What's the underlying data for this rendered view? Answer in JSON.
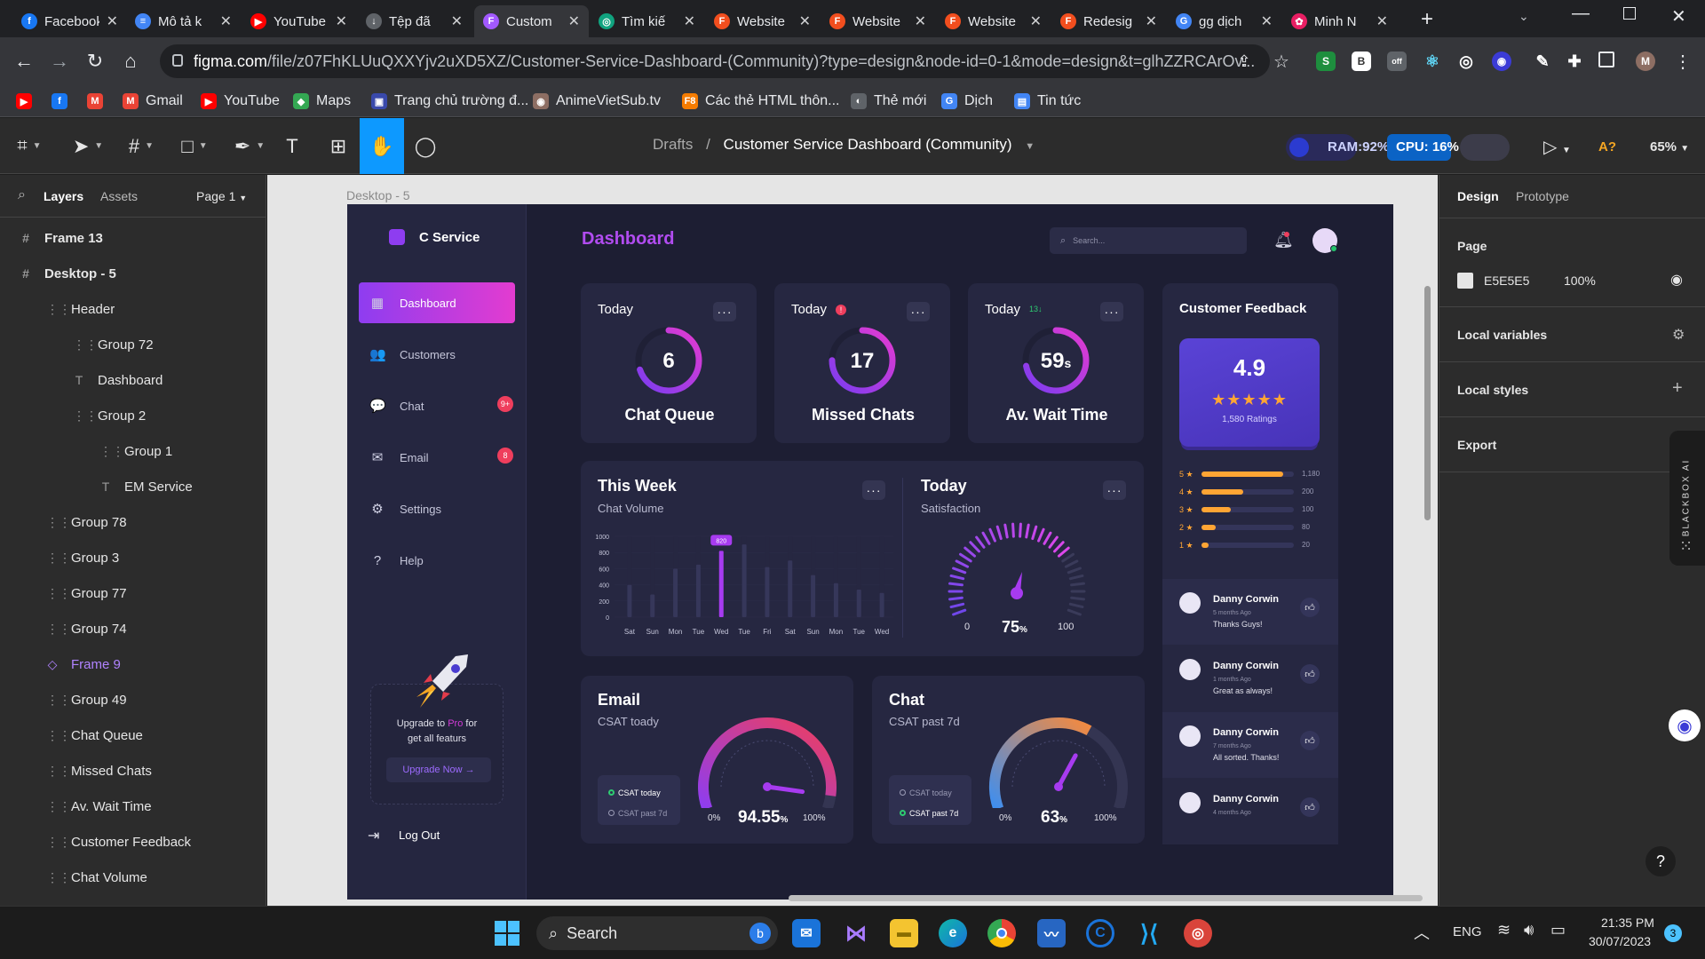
{
  "browser": {
    "tabs": [
      {
        "label": "Facebook",
        "color": "#1877f2",
        "glyph": "f"
      },
      {
        "label": "Mô tả k",
        "color": "#4285f4",
        "glyph": "≡"
      },
      {
        "label": "YouTube",
        "color": "#ff0000",
        "glyph": "▶"
      },
      {
        "label": "Tệp đã",
        "color": "#5f6368",
        "glyph": "↓"
      },
      {
        "label": "Custom",
        "color": "#a259ff",
        "glyph": "F"
      },
      {
        "label": "Tìm kiế",
        "color": "#10a37f",
        "glyph": "◎"
      },
      {
        "label": "Website",
        "color": "#f24e1e",
        "glyph": "F"
      },
      {
        "label": "Website",
        "color": "#f24e1e",
        "glyph": "F"
      },
      {
        "label": "Website",
        "color": "#f24e1e",
        "glyph": "F"
      },
      {
        "label": "Redesig",
        "color": "#f24e1e",
        "glyph": "F"
      },
      {
        "label": "gg dịch",
        "color": "#4285f4",
        "glyph": "G"
      },
      {
        "label": "Minh N",
        "color": "#e91e63",
        "glyph": "✿"
      }
    ],
    "url_host": "figma.com",
    "url_rest": "/file/z07FhKLUuQXXYjv2uXD5XZ/Customer-Service-Dashboard-(Community)?type=design&node-id=0-1&mode=design&t=glhZZRCArOv...",
    "profile_initial": "M",
    "bookmarks": [
      {
        "label": "",
        "color": "#ff0000",
        "glyph": "▶"
      },
      {
        "label": "",
        "color": "#1877f2",
        "glyph": "f"
      },
      {
        "label": "",
        "color": "#ea4335",
        "glyph": "M"
      },
      {
        "label": "Gmail",
        "color": "#ea4335",
        "glyph": "M"
      },
      {
        "label": "YouTube",
        "color": "#ff0000",
        "glyph": "▶"
      },
      {
        "label": "Maps",
        "color": "#34a853",
        "glyph": "◆"
      },
      {
        "label": "Trang chủ trường đ...",
        "color": "#3949ab",
        "glyph": "▣"
      },
      {
        "label": "AnimeVietSub.tv",
        "color": "#8d6e63",
        "glyph": "◉"
      },
      {
        "label": "Các thẻ HTML thôn...",
        "color": "#f57c00",
        "glyph": "F8"
      },
      {
        "label": "Thẻ mới",
        "color": "#5f6368",
        "glyph": "◐"
      },
      {
        "label": "Dịch",
        "color": "#4285f4",
        "glyph": "G"
      },
      {
        "label": "Tin tức",
        "color": "#4285f4",
        "glyph": "▤"
      }
    ]
  },
  "figma": {
    "breadcrumb_parent": "Drafts",
    "breadcrumb_sep": "/",
    "file_name": "Customer Service Dashboard (Community)",
    "ram": "RAM:92%",
    "cpu": "CPU: 16%",
    "zoom": "65%",
    "font_warn": "A?",
    "layers_tab": "Layers",
    "assets_tab": "Assets",
    "page_selector": "Page 1",
    "frame_label": "Desktop - 5",
    "layers": [
      {
        "label": "Frame 13",
        "icon": "#",
        "indent": 0,
        "style": "bold"
      },
      {
        "label": "Desktop - 5",
        "icon": "#",
        "indent": 0,
        "style": "bold"
      },
      {
        "label": "Header",
        "icon": "⋮⋮",
        "indent": 1,
        "style": ""
      },
      {
        "label": "Group 72",
        "icon": "⋮⋮",
        "indent": 2,
        "style": ""
      },
      {
        "label": "Dashboard",
        "icon": "T",
        "indent": 2,
        "style": ""
      },
      {
        "label": "Group 2",
        "icon": "⋮⋮",
        "indent": 2,
        "style": ""
      },
      {
        "label": "Group 1",
        "icon": "⋮⋮",
        "indent": 3,
        "style": ""
      },
      {
        "label": "EM Service",
        "icon": "T",
        "indent": 3,
        "style": ""
      },
      {
        "label": "Group 78",
        "icon": "⋮⋮",
        "indent": 1,
        "style": ""
      },
      {
        "label": "Group 3",
        "icon": "⋮⋮",
        "indent": 1,
        "style": ""
      },
      {
        "label": "Group 77",
        "icon": "⋮⋮",
        "indent": 1,
        "style": ""
      },
      {
        "label": "Group 74",
        "icon": "⋮⋮",
        "indent": 1,
        "style": ""
      },
      {
        "label": "Frame 9",
        "icon": "◇",
        "indent": 1,
        "style": "purple"
      },
      {
        "label": "Group 49",
        "icon": "⋮⋮",
        "indent": 1,
        "style": ""
      },
      {
        "label": "Chat Queue",
        "icon": "⋮⋮",
        "indent": 1,
        "style": ""
      },
      {
        "label": "Missed Chats",
        "icon": "⋮⋮",
        "indent": 1,
        "style": ""
      },
      {
        "label": "Av. Wait Time",
        "icon": "⋮⋮",
        "indent": 1,
        "style": ""
      },
      {
        "label": "Customer Feedback",
        "icon": "⋮⋮",
        "indent": 1,
        "style": ""
      },
      {
        "label": "Chat Volume",
        "icon": "⋮⋮",
        "indent": 1,
        "style": ""
      }
    ],
    "right": {
      "design_tab": "Design",
      "prototype_tab": "Prototype",
      "page_heading": "Page",
      "page_color": "E5E5E5",
      "page_opacity": "100%",
      "local_variables": "Local variables",
      "local_styles": "Local styles",
      "export": "Export",
      "blackbox": "BLACKBOX AI",
      "help": "?"
    }
  },
  "dashboard": {
    "brand": "C Service",
    "title": "Dashboard",
    "search_placeholder": "Search...",
    "nav": [
      {
        "label": "Dashboard",
        "icon": "▦",
        "badge": ""
      },
      {
        "label": "Customers",
        "icon": "👥",
        "badge": ""
      },
      {
        "label": "Chat",
        "icon": "💬",
        "badge": "9+"
      },
      {
        "label": "Email",
        "icon": "✉",
        "badge": "8"
      },
      {
        "label": "Settings",
        "icon": "⚙",
        "badge": ""
      },
      {
        "label": "Help",
        "icon": "?",
        "badge": ""
      }
    ],
    "upgrade_text_1": "Upgrade to ",
    "upgrade_pro": "Pro",
    "upgrade_text_2": " for",
    "upgrade_text_3": "get all featurs",
    "upgrade_button": "Upgrade Now →",
    "logout": "Log Out",
    "kpis": [
      {
        "period": "Today",
        "value": "6",
        "label": "Chat Queue",
        "fill": 0.7,
        "extra": ""
      },
      {
        "period": "Today",
        "value": "17",
        "label": "Missed Chats",
        "fill": 0.75,
        "extra": "!"
      },
      {
        "period": "Today",
        "value": "59",
        "unit": "s",
        "label": "Av. Wait Time",
        "fill": 0.72,
        "extra": "13↓"
      }
    ],
    "week": {
      "title": "This Week",
      "subtitle": "Chat Volume",
      "highlight": "820"
    },
    "satisfaction": {
      "title": "Today",
      "subtitle": "Satisfaction",
      "value": "75",
      "unit": "%",
      "min": "0",
      "max": "100"
    },
    "email": {
      "title": "Email",
      "subtitle": "CSAT toady",
      "value": "94.55",
      "unit": "%",
      "min": "0%",
      "max": "100%",
      "legend": [
        "CSAT today",
        "CSAT past 7d"
      ]
    },
    "chat": {
      "title": "Chat",
      "subtitle": "CSAT past 7d",
      "value": "63",
      "unit": "%",
      "min": "0%",
      "max": "100%",
      "legend": [
        "CSAT today",
        "CSAT past 7d"
      ]
    },
    "feedback": {
      "title": "Customer Feedback",
      "rating": "4.9",
      "stars": "★★★★★",
      "ratings_count": "1,580 Ratings",
      "breakdown": [
        {
          "label": "5 ★",
          "count": "1,180",
          "pct": 0.88
        },
        {
          "label": "4 ★",
          "count": "200",
          "pct": 0.45
        },
        {
          "label": "3 ★",
          "count": "100",
          "pct": 0.32
        },
        {
          "label": "2 ★",
          "count": "80",
          "pct": 0.15
        },
        {
          "label": "1 ★",
          "count": "20",
          "pct": 0.08
        }
      ],
      "reviews": [
        {
          "name": "Danny Corwin",
          "ago": "5 months Ago",
          "msg": "Thanks Guys!"
        },
        {
          "name": "Danny Corwin",
          "ago": "1 months Ago",
          "msg": "Great as always!"
        },
        {
          "name": "Danny Corwin",
          "ago": "7 months Ago",
          "msg": "All sorted. Thanks!"
        },
        {
          "name": "Danny Corwin",
          "ago": "4 months Ago",
          "msg": ""
        }
      ]
    }
  },
  "chart_data": {
    "type": "bar",
    "title": "This Week",
    "subtitle": "Chat Volume",
    "categories": [
      "Sat",
      "Sun",
      "Mon",
      "Tue",
      "Wed",
      "Tue",
      "Fri",
      "Sat",
      "Sun",
      "Mon",
      "Tue",
      "Wed"
    ],
    "values": [
      400,
      280,
      600,
      650,
      820,
      900,
      620,
      700,
      520,
      420,
      340,
      300
    ],
    "highlight_index": 4,
    "yticks": [
      "0",
      "200",
      "400",
      "600",
      "800",
      "1000"
    ],
    "ylim": [
      0,
      1000
    ],
    "xlabel": "",
    "ylabel": ""
  },
  "taskbar": {
    "search": "Search",
    "lang": "ENG",
    "time": "21:35 PM",
    "date": "30/07/2023",
    "notif": "3"
  }
}
